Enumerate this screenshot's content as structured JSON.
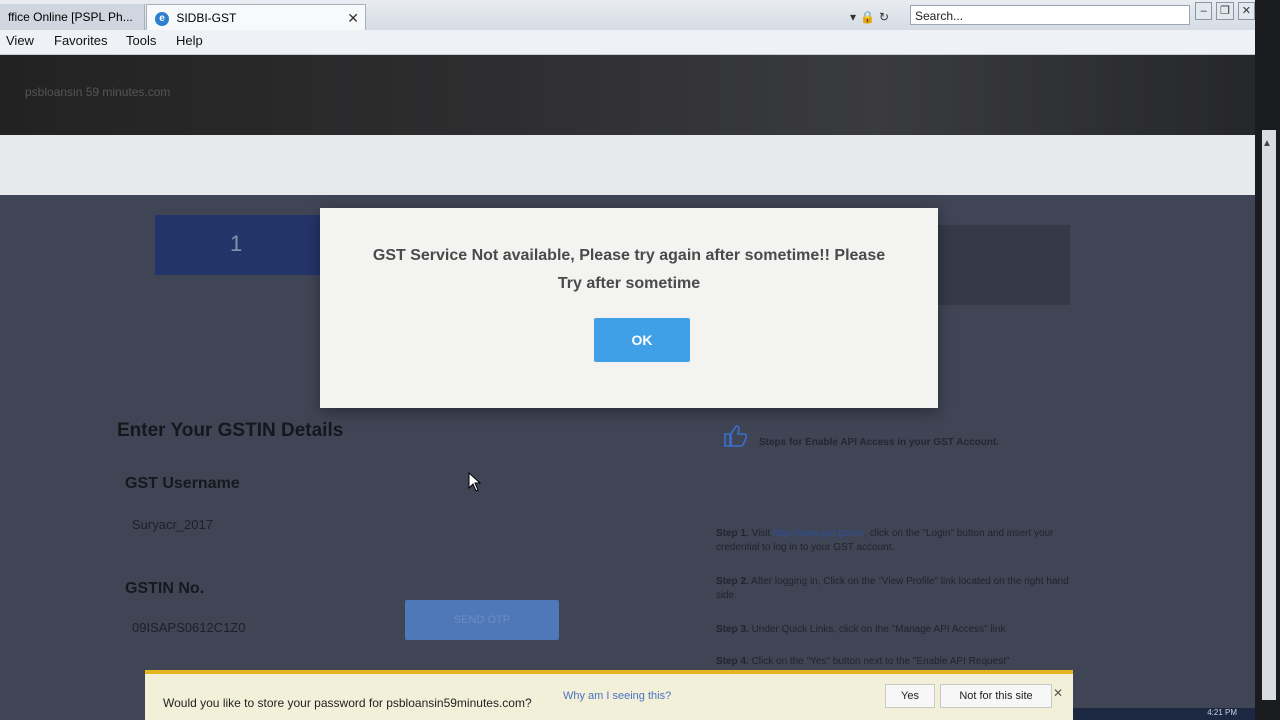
{
  "browser": {
    "tabs": [
      {
        "label": "ffice Online [PSPL Ph..."
      },
      {
        "label": "SIDBI-GST"
      }
    ],
    "search_placeholder": "Search...",
    "menu": [
      "View",
      "Favorites",
      "Tools",
      "Help"
    ]
  },
  "page": {
    "site_name": "psbloansin 59 minutes.com",
    "gstin_title": "Enter Your GSTIN Details",
    "fields": [
      {
        "label": "GST Username",
        "value": "Suryacr_2017"
      },
      {
        "label": "GSTIN No.",
        "value": "09ISAPS0612C1Z0"
      }
    ],
    "send_otp_label": "SEND OTP",
    "api": {
      "header": "Steps for Enable API Access in your GST Account.",
      "steps": [
        {
          "label": "Step 1.",
          "text_a": " Visit ",
          "link": "http://www.gst.gov.in",
          "text_b": ", click on the \"Login\" button and insert your credential to log in to your GST account."
        },
        {
          "label": "Step 2.",
          "text": " After logging in, Click on the \"View Profile\" link located on the right hand side."
        },
        {
          "label": "Step 3.",
          "text": " Under Quick Links, click on the \"Manage API Access\" link"
        },
        {
          "label": "Step 4.",
          "text": " Click on the \"Yes\" button next to the \"Enable API Request\""
        }
      ]
    }
  },
  "modal": {
    "message": "GST Service Not available, Please try again after sometime!! Please Try after sometime",
    "ok_label": "OK"
  },
  "password_bar": {
    "prompt": "Would you like to store your password for psbloansin59minutes.com?",
    "why_link": "Why am I seeing this?",
    "yes_label": "Yes",
    "never_label": "Not for this site"
  },
  "taskbar": {
    "clock": "4:21 PM"
  },
  "colors": {
    "ok_button": "#3fa0e8",
    "password_bar_border": "#e4b51e",
    "page_body": "#3f4555"
  }
}
